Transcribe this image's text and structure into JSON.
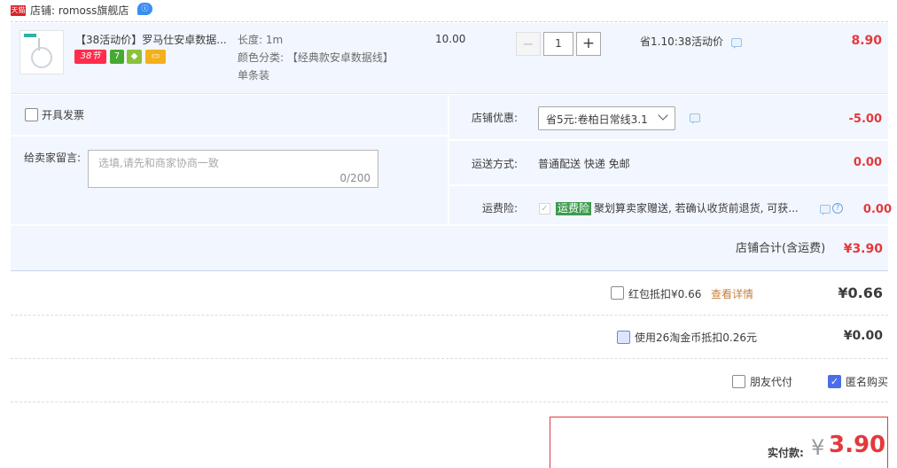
{
  "store": {
    "badge": "天猫",
    "label": "店铺: romoss旗舰店",
    "chat_icon": "wangwang-chat-icon"
  },
  "item": {
    "title": "【38活动价】罗马仕安卓数据...",
    "badges": [
      "38节",
      "7",
      "",
      ""
    ],
    "attrs": {
      "length": "长度: 1m",
      "color": "颜色分类: 【经典款安卓数据线】",
      "pack": "单条装"
    },
    "unit_price": "10.00",
    "quantity": "1",
    "promo": "省1.10:38活动价",
    "subtotal": "8.90"
  },
  "options": {
    "invoice_label": "开具发票",
    "message_label": "给卖家留言:",
    "message_placeholder": "选填,请先和商家协商一致",
    "message_count": "0/200",
    "coupon_label": "店铺优惠:",
    "coupon_value": "省5元:卷柏日常线3.1",
    "coupon_amount": "-5.00",
    "shipping_label": "运送方式:",
    "shipping_value": "普通配送 快递 免邮",
    "shipping_amount": "0.00",
    "insurance_label": "运费险:",
    "insurance_tag": "运费险",
    "insurance_text": "聚划算卖家赠送, 若确认收货前退货, 可获...",
    "insurance_amount": "0.00"
  },
  "store_total": {
    "label": "店铺合计(含运费)",
    "amount": "¥3.90"
  },
  "discounts": {
    "redpacket_label": "红包抵扣¥0.66",
    "redpacket_link": "查看详情",
    "redpacket_amount": "¥0.66",
    "coins_label": "使用26淘金币抵扣0.26元",
    "coins_amount": "¥0.00"
  },
  "payment_options": {
    "friend_pay": "朋友代付",
    "anonymous": "匿名购买"
  },
  "pay": {
    "label": "实付款:",
    "currency": "¥",
    "amount": "3.90"
  },
  "colors": {
    "accent_red": "#e4393c",
    "panel_bg": "#f2f6fe",
    "tmall_red": "#d8232a"
  }
}
